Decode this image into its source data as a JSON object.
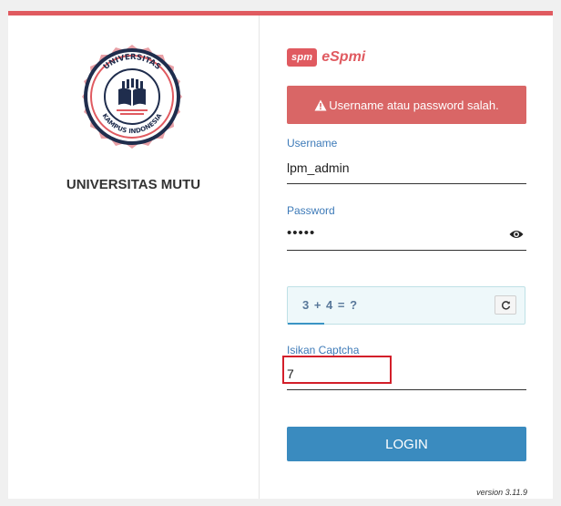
{
  "university": {
    "name": "UNIVERSITAS MUTU",
    "seal_text_top": "UNIVERSITAS",
    "seal_text_bottom": "KAMPUS INDONESIA"
  },
  "brand": {
    "badge": "spm",
    "name": "eSpmi",
    "color": "#e05a60"
  },
  "alert": {
    "message": "Username atau password salah.",
    "icon": "warning-icon"
  },
  "form": {
    "username_label": "Username",
    "username_value": "lpm_admin",
    "password_label": "Password",
    "password_masked": "•••••",
    "captcha_question": "3 + 4 = ?",
    "captcha_label": "Isikan Captcha",
    "captcha_value": "7"
  },
  "login_label": "LOGIN",
  "version": "version 3.11.9",
  "colors": {
    "accent": "#e05a60",
    "label": "#3d7ab8",
    "button": "#3a8bbf",
    "alert": "#d96666"
  }
}
